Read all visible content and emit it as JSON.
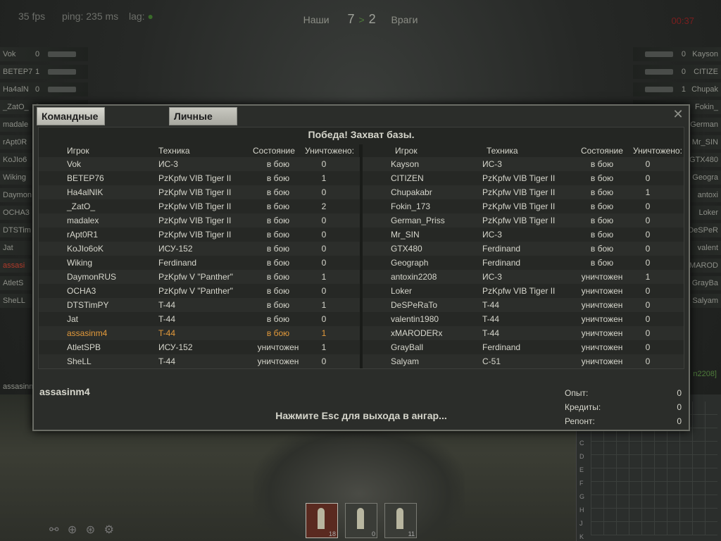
{
  "hud": {
    "fps": "35 fps",
    "ping": "ping: 235 ms",
    "lag": "lag:",
    "team_ours": "Наши",
    "score_ours": "7",
    "score_arrow": ">",
    "score_enemy": "2",
    "team_enemy": "Враги",
    "timer": "00:37"
  },
  "left_list": [
    {
      "name": "Vok",
      "frags": "0"
    },
    {
      "name": "BETEP7",
      "frags": "1"
    },
    {
      "name": "Ha4alN",
      "frags": "0"
    },
    {
      "name": "_ZatO_",
      "frags": "2"
    },
    {
      "name": "madale",
      "frags": "0"
    },
    {
      "name": "rApt0R",
      "frags": ""
    },
    {
      "name": "KoJIo6",
      "frags": ""
    },
    {
      "name": "Wiking",
      "frags": ""
    },
    {
      "name": "Daymon",
      "frags": ""
    },
    {
      "name": "OCHA3",
      "frags": ""
    },
    {
      "name": "DTSTim",
      "frags": ""
    },
    {
      "name": "Jat",
      "frags": ""
    },
    {
      "name": "assasi",
      "frags": ""
    },
    {
      "name": "AtletS",
      "frags": ""
    },
    {
      "name": "SheLL",
      "frags": ""
    }
  ],
  "right_list": [
    {
      "name": "Kayson",
      "frags": "0"
    },
    {
      "name": "CITIZE",
      "frags": "0"
    },
    {
      "name": "Chupak",
      "frags": "1"
    },
    {
      "name": "Fokin_",
      "frags": ""
    },
    {
      "name": "German",
      "frags": ""
    },
    {
      "name": "Mr_SIN",
      "frags": ""
    },
    {
      "name": "GTX480",
      "frags": ""
    },
    {
      "name": "Geogra",
      "frags": ""
    },
    {
      "name": "antoxi",
      "frags": ""
    },
    {
      "name": "Loker",
      "frags": ""
    },
    {
      "name": "DeSPeR",
      "frags": ""
    },
    {
      "name": "valent",
      "frags": ""
    },
    {
      "name": "xMAROD",
      "frags": ""
    },
    {
      "name": "GrayBa",
      "frags": ""
    },
    {
      "name": "Salyam",
      "frags": ""
    }
  ],
  "dialog": {
    "tab_team": "Командные достижения",
    "tab_personal": "Личные достижения",
    "close": "✕",
    "result": "Победа! Захват базы.",
    "headers": {
      "player": "Игрок",
      "vehicle": "Техника",
      "state": "Состояние",
      "kills": "Уничтожено:"
    },
    "team_left": [
      {
        "player": "Vok",
        "vehicle": "ИС-3",
        "state": "в бою",
        "kills": "0"
      },
      {
        "player": "BETEP76",
        "vehicle": "PzKpfw VIB Tiger II",
        "state": "в бою",
        "kills": "1"
      },
      {
        "player": "Ha4alNIK",
        "vehicle": "PzKpfw VIB Tiger II",
        "state": "в бою",
        "kills": "0"
      },
      {
        "player": "_ZatO_",
        "vehicle": "PzKpfw VIB Tiger II",
        "state": "в бою",
        "kills": "2"
      },
      {
        "player": "madalex",
        "vehicle": "PzKpfw VIB Tiger II",
        "state": "в бою",
        "kills": "0"
      },
      {
        "player": "rApt0R1",
        "vehicle": "PzKpfw VIB Tiger II",
        "state": "в бою",
        "kills": "0"
      },
      {
        "player": "KoJIo6oK",
        "vehicle": "ИСУ-152",
        "state": "в бою",
        "kills": "0"
      },
      {
        "player": "Wiking",
        "vehicle": "Ferdinand",
        "state": "в бою",
        "kills": "0"
      },
      {
        "player": "DaymonRUS",
        "vehicle": "PzKpfw V \"Panther\"",
        "state": "в бою",
        "kills": "1"
      },
      {
        "player": "OCHA3",
        "vehicle": "PzKpfw V \"Panther\"",
        "state": "в бою",
        "kills": "0"
      },
      {
        "player": "DTSTimPY",
        "vehicle": "T-44",
        "state": "в бою",
        "kills": "1"
      },
      {
        "player": "Jat",
        "vehicle": "T-44",
        "state": "в бою",
        "kills": "0"
      },
      {
        "player": "assasinm4",
        "vehicle": "T-44",
        "state": "в бою",
        "kills": "1"
      },
      {
        "player": "AtletSPB",
        "vehicle": "ИСУ-152",
        "state": "уничтожен",
        "kills": "1"
      },
      {
        "player": "SheLL",
        "vehicle": "T-44",
        "state": "уничтожен",
        "kills": "0"
      }
    ],
    "team_right": [
      {
        "player": "Kayson",
        "vehicle": "ИС-3",
        "state": "в бою",
        "kills": "0"
      },
      {
        "player": "CITIZEN",
        "vehicle": "PzKpfw VIB Tiger II",
        "state": "в бою",
        "kills": "0"
      },
      {
        "player": "Chupakabr",
        "vehicle": "PzKpfw VIB Tiger II",
        "state": "в бою",
        "kills": "1"
      },
      {
        "player": "Fokin_173",
        "vehicle": "PzKpfw VIB Tiger II",
        "state": "в бою",
        "kills": "0"
      },
      {
        "player": "German_Priss",
        "vehicle": "PzKpfw VIB Tiger II",
        "state": "в бою",
        "kills": "0"
      },
      {
        "player": "Mr_SIN",
        "vehicle": "ИС-3",
        "state": "в бою",
        "kills": "0"
      },
      {
        "player": "GTX480",
        "vehicle": "Ferdinand",
        "state": "в бою",
        "kills": "0"
      },
      {
        "player": "Geograph",
        "vehicle": "Ferdinand",
        "state": "в бою",
        "kills": "0"
      },
      {
        "player": "antoxin2208",
        "vehicle": "ИС-3",
        "state": "уничтожен",
        "kills": "1"
      },
      {
        "player": "Loker",
        "vehicle": "PzKpfw VIB Tiger II",
        "state": "уничтожен",
        "kills": "0"
      },
      {
        "player": "DeSPeRaTo",
        "vehicle": "T-44",
        "state": "уничтожен",
        "kills": "0"
      },
      {
        "player": "valentin1980",
        "vehicle": "T-44",
        "state": "уничтожен",
        "kills": "0"
      },
      {
        "player": "xMARODERx",
        "vehicle": "T-44",
        "state": "уничтожен",
        "kills": "0"
      },
      {
        "player": "GrayBall",
        "vehicle": "Ferdinand",
        "state": "уничтожен",
        "kills": "0"
      },
      {
        "player": "Salyam",
        "vehicle": "С-51",
        "state": "уничтожен",
        "kills": "0"
      }
    ],
    "current_player": "assasinm4",
    "exit_hint": "Нажмите Esc для выхода в ангар...",
    "stats": [
      {
        "label": "Опыт:",
        "value": "0"
      },
      {
        "label": "Кредиты:",
        "value": "0"
      },
      {
        "label": "Репонт:",
        "value": "0"
      }
    ]
  },
  "bottom_hud": {
    "left_player": "assasinm4",
    "right_player": "n2208]",
    "ammo": [
      {
        "count": "18",
        "selected": true
      },
      {
        "count": "0",
        "selected": false
      },
      {
        "count": "11",
        "selected": false
      }
    ],
    "minimap_letters": [
      "C",
      "D",
      "E",
      "F",
      "G",
      "H",
      "J",
      "K"
    ],
    "accent_colors": {
      "highlight": "#e39a3b",
      "enemy_timer": "#7a1e1e",
      "ally": "#4e7c3a"
    }
  }
}
